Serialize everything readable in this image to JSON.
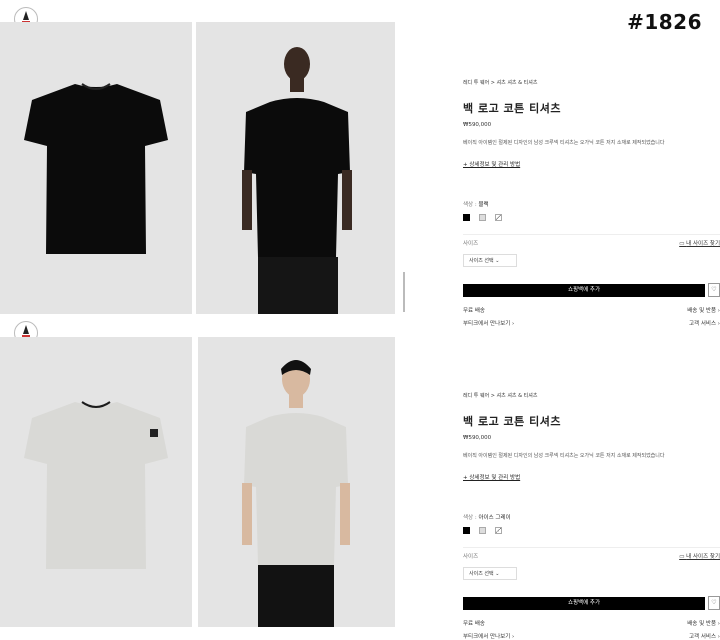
{
  "tag": "#1826",
  "brand_logo": "MONCLER",
  "products": [
    {
      "breadcrumb": "레디 투 웨어 > 셔츠 셔츠 & 티셔츠",
      "name": "백 로고 코튼 티셔츠",
      "price": "₩590,000",
      "description": "베이직 아이템인 절제된 디자인의 남성 크루넥 티셔츠는 오가닉 코튼 저지 소재로 제작되었습니다",
      "details_link": "+ 상세정보 및 관리 방법",
      "color_label": "색상 :",
      "color_value": "블랙",
      "size_label": "사이즈",
      "size_guide": "내 사이즈 찾기",
      "size_select": "사이즈 선택",
      "add_to_bag": "쇼핑백에 추가",
      "shipping": "무료 배송",
      "shipping_returns": "배송 및 반품",
      "boutique": "부티크에서 만나보기",
      "customer_service": "고객 서비스",
      "shirt_color": "#0b0b0b"
    },
    {
      "breadcrumb": "레디 투 웨어 > 셔츠 셔츠 & 티셔츠",
      "name": "백 로고 코튼 티셔츠",
      "price": "₩590,000",
      "description": "베이직 아이템인 절제된 디자인의 남성 크루넥 티셔츠는 오가닉 코튼 저지 소재로 제작되었습니다",
      "details_link": "+ 상세정보 및 관리 방법",
      "color_label": "색상 :",
      "color_value": "아이스 그레이",
      "size_label": "사이즈",
      "size_guide": "내 사이즈 찾기",
      "size_select": "사이즈 선택",
      "add_to_bag": "쇼핑백에 추가",
      "shipping": "무료 배송",
      "shipping_returns": "배송 및 반품",
      "boutique": "부티크에서 만나보기",
      "customer_service": "고객 서비스",
      "shirt_color": "#d9d9d6"
    }
  ]
}
